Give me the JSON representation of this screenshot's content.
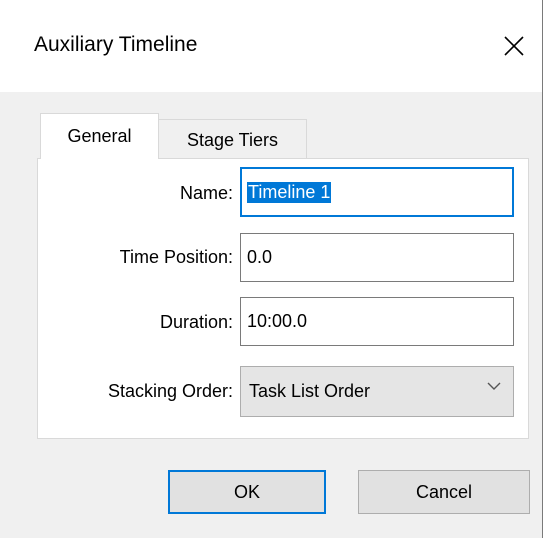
{
  "dialog": {
    "title": "Auxiliary Timeline"
  },
  "tabs": [
    {
      "label": "General",
      "active": true
    },
    {
      "label": "Stage Tiers",
      "active": false
    }
  ],
  "form": {
    "name_label": "Name:",
    "name_value": "Timeline 1",
    "time_position_label": "Time Position:",
    "time_position_value": "0.0",
    "duration_label": "Duration:",
    "duration_value": "10:00.0",
    "stacking_order_label": "Stacking Order:",
    "stacking_order_value": "Task List Order"
  },
  "buttons": {
    "ok_label": "OK",
    "cancel_label": "Cancel"
  },
  "icons": {
    "close": "close-icon",
    "dropdown": "chevron-down-icon"
  },
  "colors": {
    "accent": "#0078d7",
    "window_bg": "#f0f0f0"
  }
}
